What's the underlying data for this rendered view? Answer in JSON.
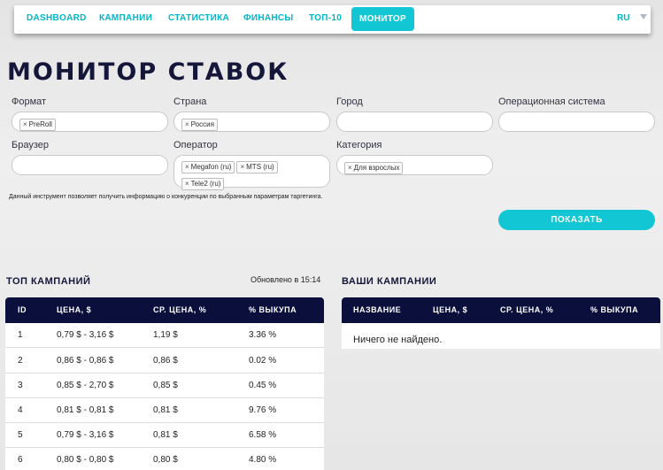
{
  "nav": {
    "items": [
      {
        "label": "DASHBOARD",
        "active": false
      },
      {
        "label": "КАМПАНИИ",
        "active": false
      },
      {
        "label": "СТАТИСТИКА",
        "active": false
      },
      {
        "label": "ФИНАНСЫ",
        "active": false
      },
      {
        "label": "ТОП-10",
        "active": false
      },
      {
        "label": "МОНИТОР",
        "active": true
      }
    ],
    "language": "RU"
  },
  "page_title": "МОНИТОР СТАВОК",
  "filters": {
    "format": {
      "label": "Формат",
      "tags": [
        "PreRoll"
      ]
    },
    "country": {
      "label": "Страна",
      "tags": [
        "Россия"
      ]
    },
    "city": {
      "label": "Город",
      "tags": []
    },
    "os": {
      "label": "Операционная система",
      "tags": []
    },
    "browser": {
      "label": "Браузер",
      "tags": []
    },
    "operator": {
      "label": "Оператор",
      "tags": [
        "Megafon (ru)",
        "MTS (ru)",
        "Tele2 (ru)"
      ]
    },
    "category": {
      "label": "Категория",
      "tags": [
        "Для взрослых"
      ]
    }
  },
  "note": "Данный инструмент позволяет получить информацию о конкуренции по выбранным параметрам таргетинга.",
  "show_button": "ПОКАЗАТЬ",
  "top_campaigns": {
    "title": "ТОП КАМПАНИЙ",
    "updated": "Обновлено в 15:14",
    "columns": [
      "ID",
      "ЦЕНА, $",
      "СР. ЦЕНА, %",
      "% ВЫКУПА"
    ],
    "rows": [
      [
        "1",
        "0,79 $ - 3,16 $",
        "1,19 $",
        "3.36 %"
      ],
      [
        "2",
        "0,86 $ - 0,86 $",
        "0,86 $",
        "0.02 %"
      ],
      [
        "3",
        "0,85 $ - 2,70 $",
        "0,85 $",
        "0.45 %"
      ],
      [
        "4",
        "0,81 $ - 0,81 $",
        "0,81 $",
        "9.76 %"
      ],
      [
        "5",
        "0,79 $ - 3,16 $",
        "0,81 $",
        "6.58 %"
      ],
      [
        "6",
        "0,80 $ - 0,80 $",
        "0,80 $",
        "4.80 %"
      ]
    ]
  },
  "your_campaigns": {
    "title": "ВАШИ КАМПАНИИ",
    "columns": [
      "НАЗВАНИЕ",
      "ЦЕНА, $",
      "СР. ЦЕНА, %",
      "% ВЫКУПА"
    ],
    "empty_text": "Ничего не найдено."
  },
  "colors": {
    "accent": "#13c6d3",
    "header_dark": "#0b0f3c",
    "title": "#14163a"
  }
}
